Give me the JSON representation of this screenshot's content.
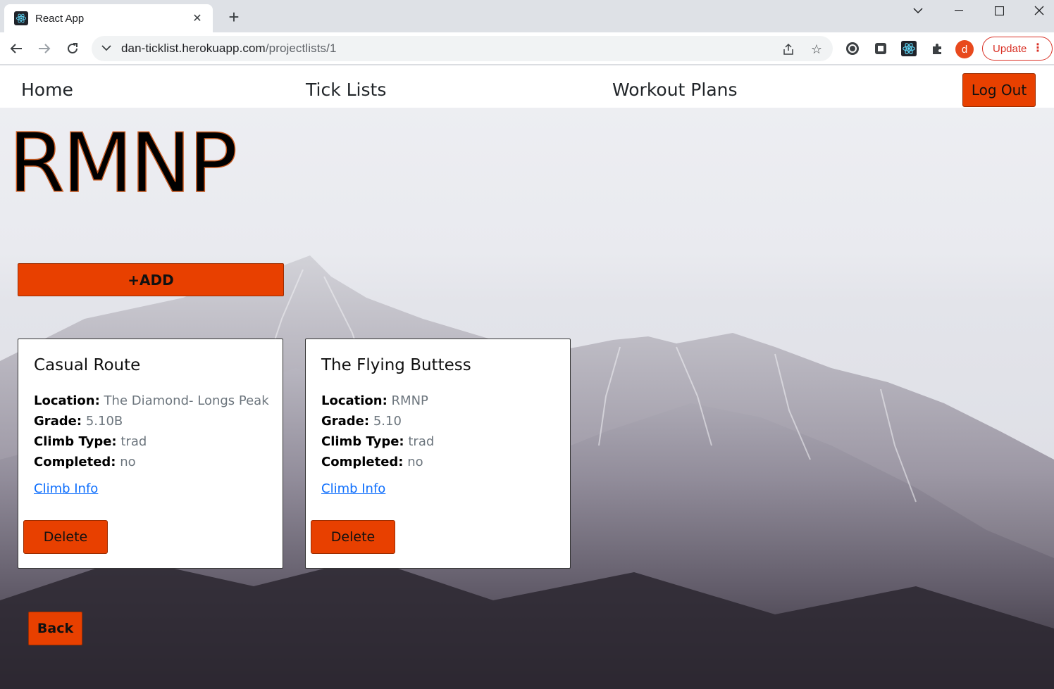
{
  "browser": {
    "tab_title": "React App",
    "url_host": "dan-ticklist.herokuapp.com",
    "url_path": "/projectlists/1",
    "update_label": "Update",
    "profile_initial": "d"
  },
  "nav": {
    "home": "Home",
    "tick_lists": "Tick Lists",
    "workout_plans": "Workout Plans",
    "logout": "Log Out"
  },
  "page": {
    "title": "RMNP",
    "add_label": "+ADD",
    "back_label": "Back"
  },
  "field_labels": {
    "location": "Location:",
    "grade": "Grade:",
    "climb_type": "Climb Type:",
    "completed": "Completed:"
  },
  "cards": [
    {
      "title": "Casual Route",
      "location": "The Diamond- Longs Peak",
      "grade": "5.10B",
      "climb_type": "trad",
      "completed": "no",
      "link_label": "Climb Info",
      "delete_label": "Delete"
    },
    {
      "title": "The Flying Buttess",
      "location": "RMNP",
      "grade": "5.10",
      "climb_type": "trad",
      "completed": "no",
      "link_label": "Climb Info",
      "delete_label": "Delete"
    }
  ],
  "colors": {
    "accent": "#e84000",
    "link": "#0d6efd"
  }
}
